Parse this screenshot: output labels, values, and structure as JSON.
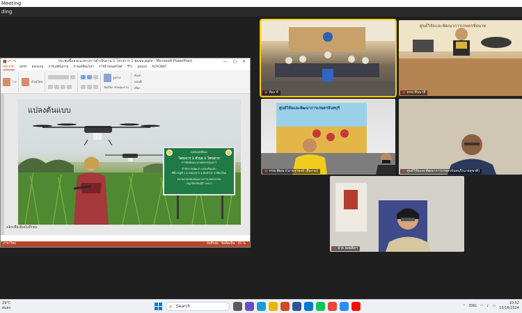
{
  "window": {
    "title": "Meeting",
    "sharing_label": "ding"
  },
  "ppt": {
    "titlebar": "ประชุมชี้แจงแนวทางการดำเนินงาน 1 โครงการ 1 ชุมชน.pptx - Microsoft PowerPoint",
    "tabs": [
      "หน้าแรก",
      "แทรก",
      "ออกแบบ",
      "การเปลี่ยนภาพ",
      "ภาพเคลื่อนไหว",
      "การนำเสนอสไลด์",
      "รีวิว",
      "มุมมอง",
      "ACROBAT"
    ],
    "ribbon": {
      "paste": "วาง",
      "new_slide": "สไลด์ใหม่",
      "shapes": "รูปร่าง",
      "arrange": "จัดเรียง",
      "quick_styles": "ลักษณะด่วน",
      "find": "ค้นหา",
      "replace": "แทนที่",
      "select": "เลือก"
    },
    "slide": {
      "title": "แปลงต้นแบบ",
      "card_header": "ผลสัมฤทธิ์ของ",
      "card_title": "โครงการ 1 ตำบล 1 โครงการ",
      "card_line1": "การจัดสัมมนาเกษตรกรรุ่นเยาว์",
      "card_line2": "สำนักงานพัฒนา แปลงต้นแบบ",
      "card_line3": "ที่ตั้ง หมู่ที่ 1 ต.หนองหาร อ.สันทราย จ.เชียงใหม่",
      "card_line4": "หน่วยงานสนับสนุนทางการเกษตรกรรม",
      "card_line5": "(ปลูกอ้อยพันธุ์ปี 2567)"
    },
    "notes_text": "คลิกเพื่อเพิ่มบันทึกย่อ",
    "status": {
      "left": "ภาษาไทย",
      "notes": "บันทึกย่อ",
      "comments": "ข้อคิดเห็น",
      "zoom": "45 %"
    }
  },
  "participants": [
    {
      "name": "ห้อง 4",
      "muted": true
    },
    {
      "name": "ทรพ.ชันนาสี",
      "muted": true
    },
    {
      "name": "ทรพ.พัฒนา(นายสุรพงษ์ เสืองาม)",
      "muted": true
    },
    {
      "name": "ศูนย์วิจัยและพัฒนาการเกษตรจันทบุรี(นายสุชาติ)",
      "muted": true
    },
    {
      "name": "ฝ่าย ผลผลิตฯ",
      "muted": true
    }
  ],
  "tile_texts": {
    "tile2_sign": "ศูนย์วิจัยและพัฒนาการเกษตรชัยนาท",
    "tile3_banner": "ศูนย์วิจัยและพัฒนาการเกษตรจันทบุรี"
  },
  "taskbar": {
    "weather_temp": "29°C",
    "weather_desc": "ฝนตก",
    "search_placeholder": "Search",
    "clock_time": "10:52",
    "clock_date": "10/16/2024",
    "lang": "ENG"
  }
}
